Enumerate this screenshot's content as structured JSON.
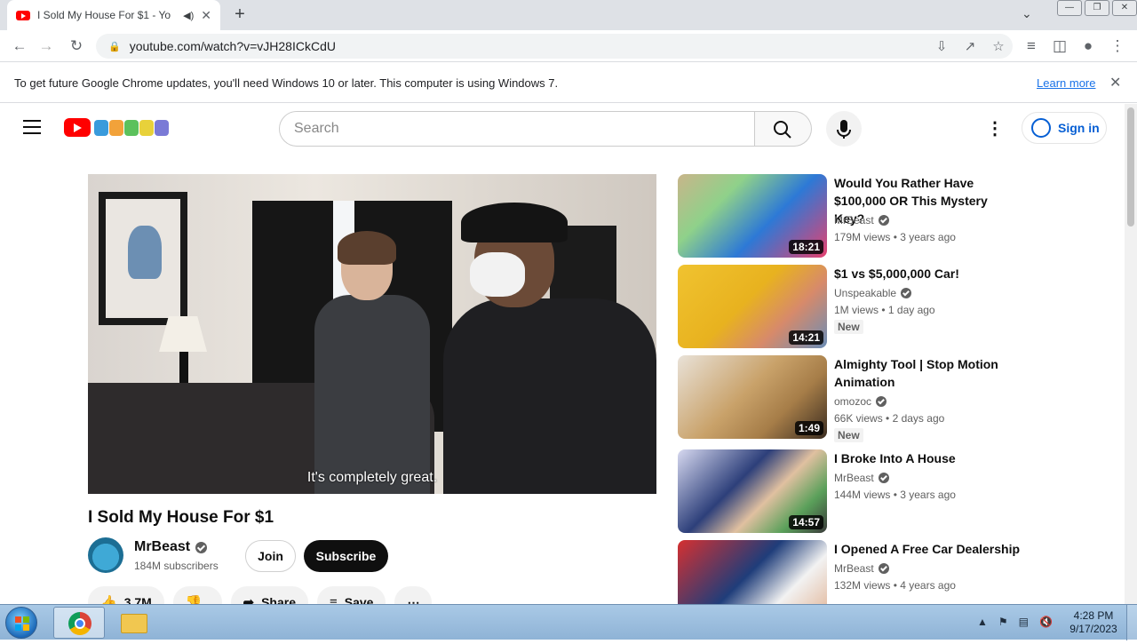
{
  "browser": {
    "tab_title": "I Sold My House For $1 - Yo",
    "audio_icon": "speaker-icon",
    "new_tab": "+",
    "url": "youtube.com/watch?v=vJH28ICkCdU",
    "infobar_text": "To get future Google Chrome updates, you'll need Windows 10 or later. This computer is using Windows 7.",
    "infobar_link": "Learn more"
  },
  "youtube": {
    "search_placeholder": "Search",
    "sign_in": "Sign in",
    "brand_color": "#ff0000"
  },
  "video": {
    "caption": "It's completely great.",
    "title": "I Sold My House For $1",
    "channel": "MrBeast",
    "subscribers": "184M subscribers",
    "join": "Join",
    "subscribe": "Subscribe",
    "likes": "3.7M",
    "share": "Share",
    "save": "Save"
  },
  "related": [
    {
      "title": "Would You Rather Have $100,000 OR This Mystery Key?",
      "channel": "MrBeast",
      "views": "179M views",
      "age": "3 years ago",
      "duration": "18:21",
      "badge": ""
    },
    {
      "title": "$1 vs $5,000,000 Car!",
      "channel": "Unspeakable",
      "views": "1M views",
      "age": "1 day ago",
      "duration": "14:21",
      "badge": "New"
    },
    {
      "title": "Almighty Tool | Stop Motion Animation",
      "channel": "omozoc",
      "views": "66K views",
      "age": "2 days ago",
      "duration": "1:49",
      "badge": "New"
    },
    {
      "title": "I Broke Into A House",
      "channel": "MrBeast",
      "views": "144M views",
      "age": "3 years ago",
      "duration": "14:57",
      "badge": ""
    },
    {
      "title": "I Opened A Free Car Dealership",
      "channel": "MrBeast",
      "views": "132M views",
      "age": "4 years ago",
      "duration": "",
      "badge": ""
    }
  ],
  "taskbar": {
    "time": "4:28 PM",
    "date": "9/17/2023"
  }
}
